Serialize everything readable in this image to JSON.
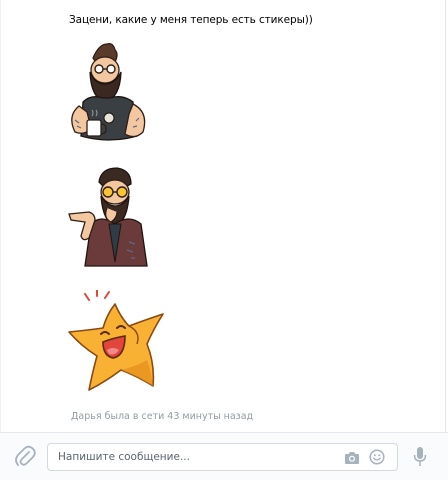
{
  "message": {
    "text": "Зацени, какие у меня теперь есть стикеры))",
    "stickers": [
      {
        "name": "bearded-hipster-coffee-sticker"
      },
      {
        "name": "bearded-man-glasses-pointing-sticker"
      },
      {
        "name": "laughing-star-sticker"
      }
    ]
  },
  "status": {
    "text": "Дарья была в сети 43 минуты назад"
  },
  "composer": {
    "placeholder": "Напишите сообщение...",
    "value": "",
    "icons": {
      "attach": "paperclip-icon",
      "camera": "camera-icon",
      "emoji": "smile-icon",
      "voice": "microphone-icon"
    }
  },
  "colors": {
    "icon": "#a7b2bf",
    "status_text": "#939aa3",
    "input_border": "#d3d9de",
    "composer_bg": "#fafbfc",
    "star": "#f8b133"
  }
}
